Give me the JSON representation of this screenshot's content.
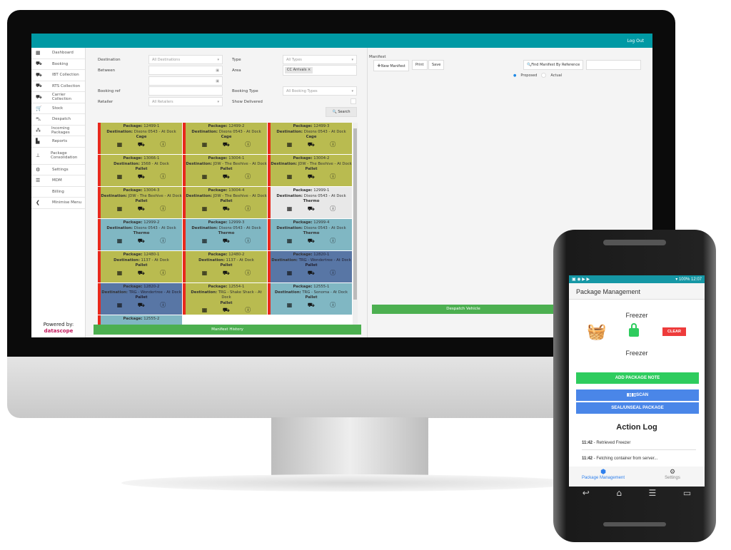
{
  "topbar": {
    "logout": "Log Out"
  },
  "sidebar": {
    "items": [
      {
        "label": "Dashboard",
        "icon": "calendar-icon",
        "glyph": "▦"
      },
      {
        "label": "Booking",
        "icon": "truck-icon",
        "glyph": "⛟"
      },
      {
        "label": "IBT Collection",
        "icon": "truck-icon",
        "glyph": "⛟"
      },
      {
        "label": "RTS Collection",
        "icon": "truck-icon",
        "glyph": "⛟"
      },
      {
        "label": "Carrier Collection",
        "icon": "truck-icon",
        "glyph": "⛟"
      },
      {
        "label": "Stock",
        "icon": "cart-icon",
        "glyph": "🛒"
      },
      {
        "label": "Despatch",
        "icon": "forklift-icon",
        "glyph": "⛍"
      },
      {
        "label": "Incoming Packages",
        "icon": "cubes-icon",
        "glyph": "⁂"
      },
      {
        "label": "Reports",
        "icon": "chart-icon",
        "glyph": "▙"
      },
      {
        "label": "Package Consolidation",
        "icon": "sitemap-icon",
        "glyph": "⊥"
      },
      {
        "label": "Settings",
        "icon": "gear-icon",
        "glyph": "⚙"
      },
      {
        "label": "MDM",
        "icon": "list-icon",
        "glyph": "☰"
      },
      {
        "label": "Billing",
        "icon": "",
        "glyph": ""
      },
      {
        "label": "Minimise Menu",
        "icon": "chevron-left-circle-icon",
        "glyph": "❮"
      }
    ],
    "powered": "Powered by:",
    "logo": "datascope"
  },
  "filters": {
    "destination_label": "Destination",
    "destination": "All Destinations",
    "between_label": "Between",
    "booking_ref_label": "Booking ref",
    "retailer_label": "Retailer",
    "retailer": "All Retailers",
    "type_label": "Type",
    "type": "All Types",
    "area_label": "Area",
    "area_tag": "CC Arrivals",
    "booking_type_label": "Booking Type",
    "booking_type": "All Booking Types",
    "show_delivered_label": "Show Delivered",
    "search": "Search"
  },
  "packages": [
    {
      "pkg": "12499-1",
      "dest": "Dixons 0543 - At Dock",
      "kind": "Cage",
      "color": "#b9bb50"
    },
    {
      "pkg": "12499-2",
      "dest": "Dixons 0543 - At Dock",
      "kind": "Cage",
      "color": "#b9bb50"
    },
    {
      "pkg": "12499-3",
      "dest": "Dixons 0543 - At Dock",
      "kind": "Cage",
      "color": "#b9bb50"
    },
    {
      "pkg": "13066-1",
      "dest": "1568 - At Dock",
      "kind": "Pallet",
      "color": "#b9bb50"
    },
    {
      "pkg": "13004-1",
      "dest": "JDW - The Beehive - At Dock",
      "kind": "Pallet",
      "color": "#b9bb50"
    },
    {
      "pkg": "13004-2",
      "dest": "JDW - The Beehive - At Dock",
      "kind": "Pallet",
      "color": "#b9bb50"
    },
    {
      "pkg": "13004-3",
      "dest": "JDW - The Beehive - At Dock",
      "kind": "Pallet",
      "color": "#b9bb50"
    },
    {
      "pkg": "13004-4",
      "dest": "JDW - The Beehive - At Dock",
      "kind": "Pallet",
      "color": "#b9bb50"
    },
    {
      "pkg": "12999-1",
      "dest": "Dixons 0543 - At Dock",
      "kind": "Thermo",
      "color": "#e8e8e8"
    },
    {
      "pkg": "12999-2",
      "dest": "Dixons 0543 - At Dock",
      "kind": "Thermo",
      "color": "#80b7c3"
    },
    {
      "pkg": "12999-3",
      "dest": "Dixons 0543 - At Dock",
      "kind": "Thermo",
      "color": "#80b7c3"
    },
    {
      "pkg": "12999-4",
      "dest": "Dixons 0543 - At Dock",
      "kind": "Thermo",
      "color": "#80b7c3"
    },
    {
      "pkg": "12480-1",
      "dest": "1137 - At Dock",
      "kind": "Pallet",
      "color": "#b9bb50"
    },
    {
      "pkg": "12480-2",
      "dest": "1137 - At Dock",
      "kind": "Pallet",
      "color": "#b9bb50"
    },
    {
      "pkg": "12820-1",
      "dest": "TRG - Wondertree - At Dock",
      "kind": "Pallet",
      "color": "#5876a5"
    },
    {
      "pkg": "12820-2",
      "dest": "TRG - Wondertree - At Dock",
      "kind": "Pallet",
      "color": "#5876a5"
    },
    {
      "pkg": "12554-1",
      "dest": "TRG - Shake Shack - At Dock",
      "kind": "Pallet",
      "color": "#b9bb50"
    },
    {
      "pkg": "12555-1",
      "dest": "TRG - Sonoma - At Dock",
      "kind": "Pallet",
      "color": "#80b7c3"
    },
    {
      "pkg": "12555-2",
      "dest": "",
      "kind": "",
      "color": "#80b7c3"
    }
  ],
  "labels": {
    "package": "Package:",
    "destination": "Destination:"
  },
  "manifest_history": "Manifest History",
  "manifest": {
    "title": "Manifest",
    "new": "New Manifest",
    "print": "Print",
    "save": "Save",
    "find": "Find Manifest By Reference",
    "proposed": "Proposed",
    "actual": "Actual",
    "despatch": "Despatch Vehicle"
  },
  "phone": {
    "status_battery": "100%",
    "status_time": "12:07",
    "title": "Package Management",
    "container_top": "Freezer",
    "container_bottom": "Freezer",
    "clear": "CLEAR",
    "add_note": "ADD PACKAGE NOTE",
    "scan": "SCAN",
    "seal": "SEAL/UNSEAL PACKAGE",
    "log_title": "Action Log",
    "log": [
      {
        "time": "11:42",
        "text": " - Retrieved Freezer"
      },
      {
        "time": "11:42",
        "text": " - Fetching container from server..."
      }
    ],
    "nav_pm": "Package Management",
    "nav_settings": "Settings"
  },
  "colors": {
    "topbar": "#0099a4",
    "green": "#4caf50",
    "phone_green": "#2ecc5e",
    "phone_blue": "#4a86e8",
    "clear_red": "#ee3b3b",
    "lock_green": "#2ecc5e"
  }
}
